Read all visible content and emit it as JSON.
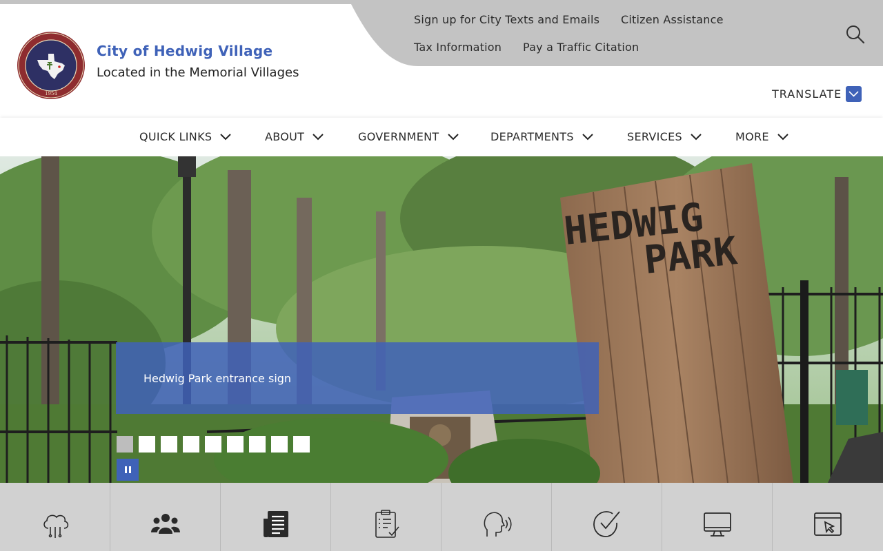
{
  "header": {
    "city_name": "City of Hedwig Village",
    "tagline": "Located in the Memorial Villages",
    "seal_text_top": "CITY OF HEDWIG VILLAGE",
    "seal_year": "1954"
  },
  "utility_links": [
    {
      "label": "Sign up for City Texts and Emails"
    },
    {
      "label": "Citizen Assistance"
    },
    {
      "label": "Tax Information"
    },
    {
      "label": "Pay a Traffic Citation"
    }
  ],
  "translate": {
    "label": "TRANSLATE"
  },
  "nav": {
    "items": [
      {
        "label": "QUICK LINKS"
      },
      {
        "label": "ABOUT"
      },
      {
        "label": "GOVERNMENT"
      },
      {
        "label": "DEPARTMENTS"
      },
      {
        "label": "SERVICES"
      },
      {
        "label": "MORE"
      }
    ]
  },
  "hero": {
    "caption": "Hedwig Park entrance sign",
    "sign_line1": "HEDWIG",
    "sign_line2": "PARK",
    "slide_count": 9,
    "active_slide": 1
  },
  "tiles": [
    {
      "icon": "cloud-storm-icon"
    },
    {
      "icon": "people-group-icon"
    },
    {
      "icon": "newspaper-icon"
    },
    {
      "icon": "clipboard-checklist-icon"
    },
    {
      "icon": "speaking-head-icon"
    },
    {
      "icon": "checkmark-circle-icon"
    },
    {
      "icon": "monitor-icon"
    },
    {
      "icon": "cursor-window-icon"
    }
  ],
  "colors": {
    "brand_blue": "#3f62b8",
    "utility_gray": "#c3c3c3",
    "tile_gray": "#d1d1d1"
  }
}
